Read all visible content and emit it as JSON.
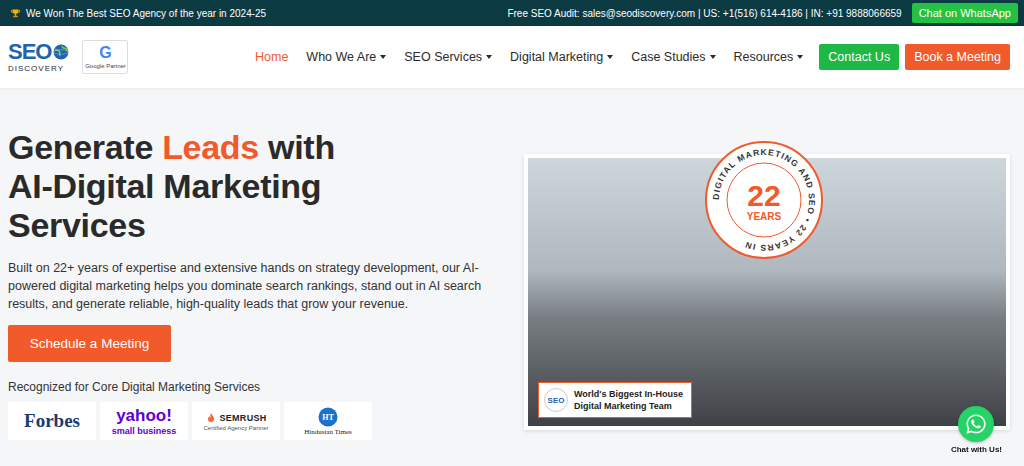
{
  "announcement": "We Won The Best SEO Agency of the year in 2024-25",
  "contact": "Free SEO Audit: sales@seodiscovery.com | US: +1(516) 614-4186 | IN: +91 9888066659",
  "top_button": "Chat on WhatsApp",
  "logo": {
    "top": "SEO",
    "bottom": "DISCOVERY"
  },
  "partner_badge": {
    "letter": "G",
    "label": "Google Partner"
  },
  "nav": [
    {
      "label": "Home",
      "selected": true,
      "dropdown": false
    },
    {
      "label": "Who We Are",
      "selected": false,
      "dropdown": true
    },
    {
      "label": "SEO Services",
      "selected": false,
      "dropdown": true
    },
    {
      "label": "Digital Marketing",
      "selected": false,
      "dropdown": true
    },
    {
      "label": "Case Studies",
      "selected": false,
      "dropdown": true
    },
    {
      "label": "Resources",
      "selected": false,
      "dropdown": true
    }
  ],
  "nav_buttons": [
    {
      "label": "Contact Us",
      "color": "#1eb845"
    },
    {
      "label": "Book a Meeting",
      "color": "#f15a2b"
    }
  ],
  "hero": {
    "title": [
      [
        {
          "text": "Generate ",
          "highlight": false
        },
        {
          "text": "Leads",
          "highlight": true
        },
        {
          "text": " with",
          "highlight": false
        }
      ],
      [
        {
          "text": "AI-Digital Marketing",
          "highlight": false
        }
      ],
      [
        {
          "text": "Services",
          "highlight": false
        }
      ]
    ],
    "description": "Built on 22+ years of expertise and extensive hands on strategy development, our AI-powered digital marketing helps you dominate search rankings, stand out in AI search results, and generate reliable, high-quality leads that grow your revenue.",
    "cta": "Schedule a Meeting",
    "recognized": "Recognized for Core Digital Marketing Services",
    "logos": [
      {
        "kind": "forbes",
        "name": "Forbes"
      },
      {
        "kind": "yahoo",
        "name": "yahoo!",
        "sub": "small business"
      },
      {
        "kind": "semrush",
        "name": "SEMRUSH",
        "sub": "Certified Agency Partner"
      },
      {
        "kind": "ht",
        "name": "Hindustan Times",
        "mark": "HT"
      }
    ]
  },
  "badge": {
    "ring": "DIGITAL MARKETING AND SEO • 22 YEARS IN",
    "number": "22",
    "unit": "YEARS"
  },
  "caption": {
    "logo": "SEO",
    "lines": [
      "World's Biggest In-House",
      "Digital Marketing Team"
    ]
  },
  "chat_widget": "Chat with Us!"
}
